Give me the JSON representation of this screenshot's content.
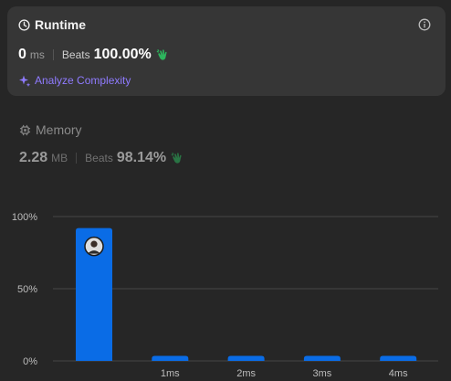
{
  "runtime": {
    "title": "Runtime",
    "value": "0",
    "unit": "ms",
    "beats_label": "Beats",
    "beats_value": "100.00%",
    "analyze_label": "Analyze Complexity"
  },
  "memory": {
    "title": "Memory",
    "value": "2.28",
    "unit": "MB",
    "beats_label": "Beats",
    "beats_value": "98.14%"
  },
  "colors": {
    "accent_bar": "#0a6ce6",
    "clap_green": "#2db55d",
    "analyze_purple": "#8f7bff"
  },
  "chart_data": {
    "type": "bar",
    "categories": [
      "",
      "1ms",
      "2ms",
      "3ms",
      "4ms"
    ],
    "values": [
      92,
      3.5,
      3.5,
      3.5,
      3.5
    ],
    "ylim": [
      0,
      100
    ],
    "yticks": [
      "0%",
      "50%",
      "100%"
    ],
    "highlight_index": 0,
    "grid": true
  }
}
